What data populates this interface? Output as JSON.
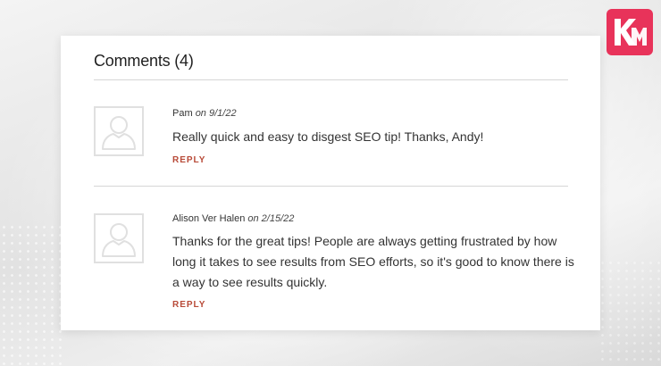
{
  "brand": {
    "accent": "#e8335a",
    "logo_icon": "km-logo-icon"
  },
  "comments_section": {
    "heading": "Comments (4)",
    "comments": [
      {
        "author": "Pam",
        "date": "on 9/1/22",
        "text": "Really quick and easy to disgest SEO tip! Thanks, Andy!",
        "reply_label": "REPLY",
        "avatar_icon": "user-placeholder-icon"
      },
      {
        "author": "Alison Ver Halen",
        "date": "on 2/15/22",
        "text": "Thanks for the great tips! People are always getting frustrated by how long it takes to see results from SEO efforts, so it's good to know there is a way to see results quickly.",
        "reply_label": "REPLY",
        "avatar_icon": "user-placeholder-icon"
      }
    ]
  },
  "colors": {
    "reply": "#b84a38",
    "divider": "#d6d6d6"
  }
}
